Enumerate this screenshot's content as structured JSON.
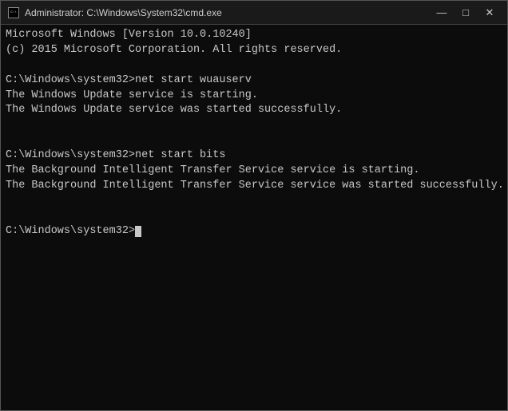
{
  "window": {
    "title": "Administrator: C:\\Windows\\System32\\cmd.exe",
    "icon": "cmd-icon"
  },
  "controls": {
    "minimize": "—",
    "maximize": "□",
    "close": "✕"
  },
  "terminal": {
    "line1": "Microsoft Windows [Version 10.0.10240]",
    "line2": "(c) 2015 Microsoft Corporation. All rights reserved.",
    "line3": "",
    "line4": "C:\\Windows\\system32>net start wuauserv",
    "line5": "The Windows Update service is starting.",
    "line6": "The Windows Update service was started successfully.",
    "line7": "",
    "line8": "",
    "line9": "C:\\Windows\\system32>net start bits",
    "line10": "The Background Intelligent Transfer Service service is starting.",
    "line11": "The Background Intelligent Transfer Service service was started successfully.",
    "line12": "",
    "line13": "",
    "line14": "C:\\Windows\\system32>"
  }
}
